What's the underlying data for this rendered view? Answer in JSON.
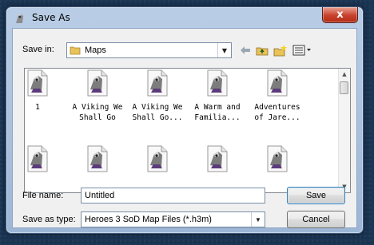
{
  "window": {
    "title": "Save As",
    "close_glyph": "x"
  },
  "toolbar": {
    "save_in_label": "Save in:",
    "save_in_value": "Maps",
    "buttons": [
      "back-arrow-icon",
      "up-folder-icon",
      "new-folder-icon",
      "view-menu-icon"
    ]
  },
  "files": [
    {
      "name": "1"
    },
    {
      "name": "A Viking We\nShall Go"
    },
    {
      "name": "A Viking We\nShall Go..."
    },
    {
      "name": "A Warm and\nFamilia..."
    },
    {
      "name": "Adventures\nof Jare..."
    },
    {
      "name": ""
    },
    {
      "name": ""
    },
    {
      "name": ""
    },
    {
      "name": ""
    },
    {
      "name": ""
    }
  ],
  "file_name": {
    "label": "File name:",
    "value": "Untitled"
  },
  "save_as_type": {
    "label": "Save as type:",
    "value": "Heroes 3 SoD Map Files (*.h3m)"
  },
  "buttons": {
    "save": "Save",
    "cancel": "Cancel"
  },
  "colors": {
    "close_red": "#c7412c",
    "frame_blue": "#9db6d6",
    "desktop": "#1b3554"
  }
}
